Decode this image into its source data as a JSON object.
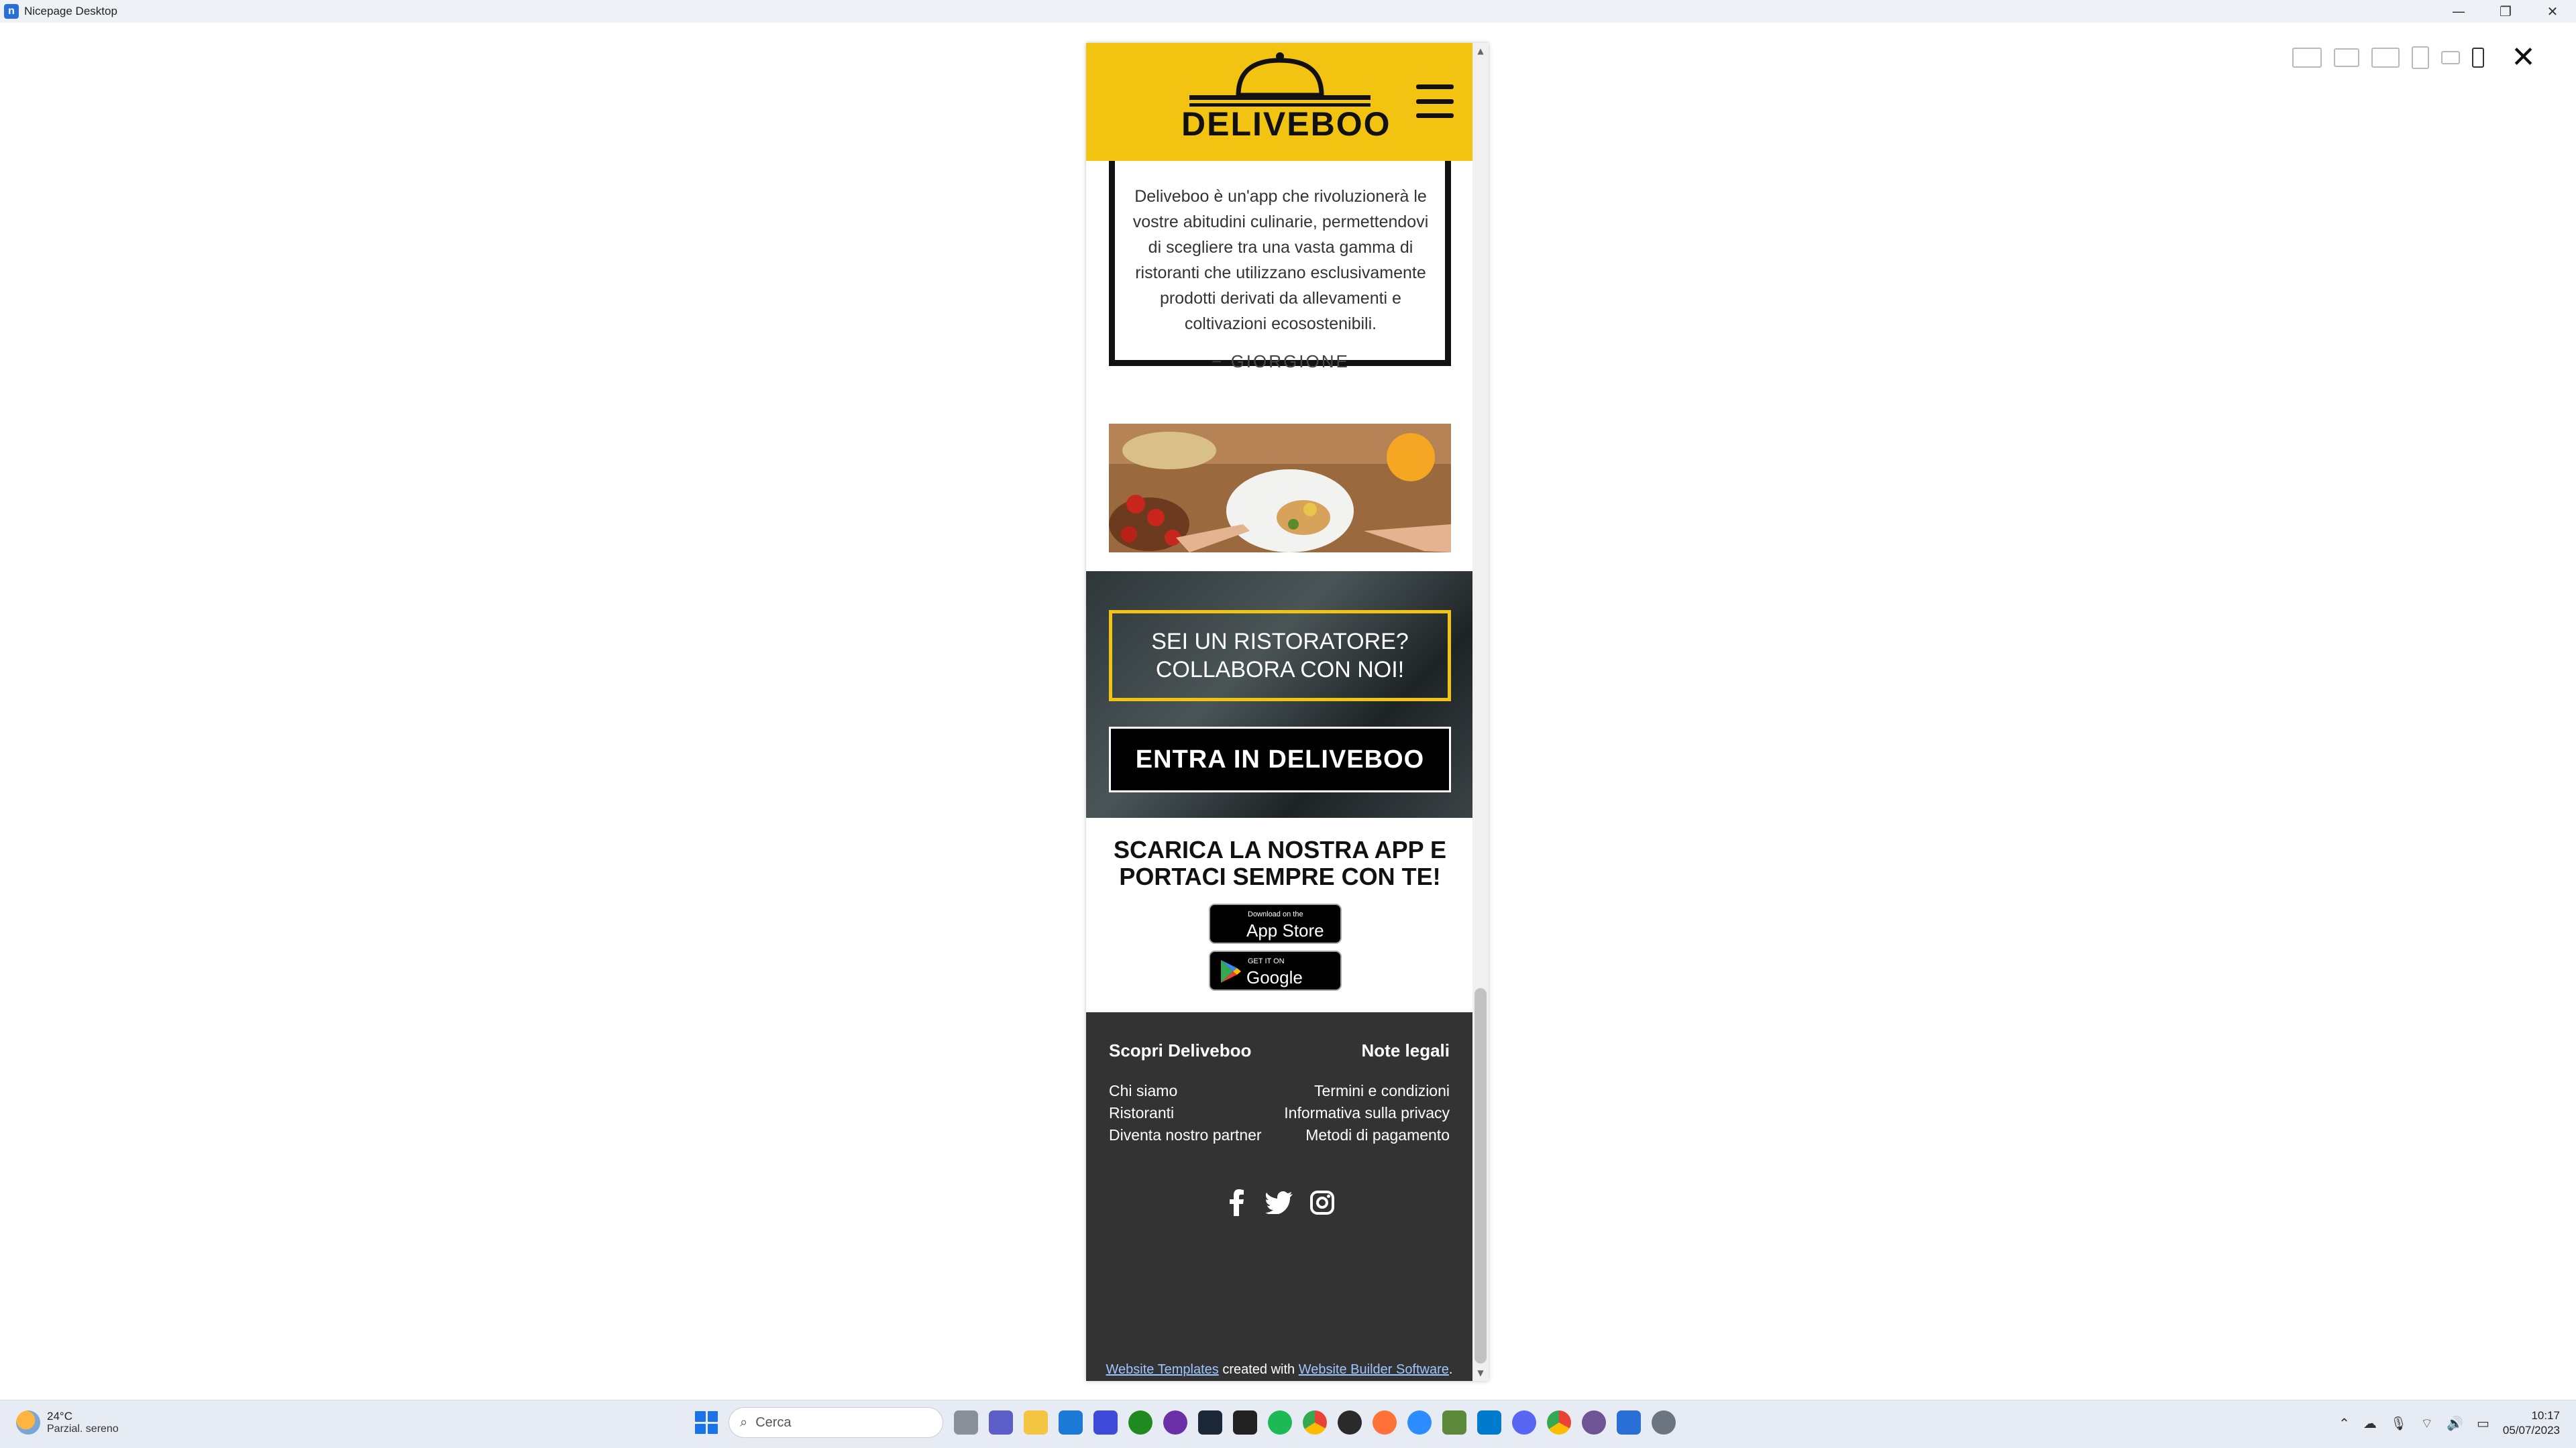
{
  "window": {
    "title": "Nicepage Desktop",
    "app_icon": "n"
  },
  "header": {
    "logo_text": "DELIVEBOO"
  },
  "testimonial": {
    "text": "Deliveboo è un'app che rivoluzionerà le vostre abitudini culinarie, permettendovi di scegliere tra una vasta gamma di ristoranti che utilizzano esclusivamente prodotti derivati da allevamenti e coltivazioni ecosostenibili.",
    "author": "− GIORGIONE"
  },
  "cta": {
    "title": "SEI UN RISTORATORE? COLLABORA CON NOI!",
    "button": "ENTRA IN DELIVEBOO"
  },
  "app_download": {
    "title": "SCARICA LA NOSTRA APP E PORTACI SEMPRE CON TE!",
    "appstore_small": "Download on the",
    "appstore_big": "App Store",
    "play_small": "GET IT ON",
    "play_big": "Google Play"
  },
  "footer": {
    "col1_title": "Scopri Deliveboo",
    "col1_links": [
      "Chi siamo",
      "Ristoranti",
      "Diventa nostro partner"
    ],
    "col2_title": "Note legali",
    "col2_links": [
      "Termini e condizioni",
      "Informativa sulla privacy",
      "Metodi di pagamento"
    ],
    "credit_link1": "Website Templates",
    "credit_mid": " created with ",
    "credit_link2": "Website Builder Software",
    "credit_end": "."
  },
  "taskbar": {
    "weather_temp": "24°C",
    "weather_desc": "Parzial. sereno",
    "search_placeholder": "Cerca",
    "time": "10:17",
    "date": "05/07/2023"
  },
  "colors": {
    "brand_yellow": "#f2c411",
    "footer_bg": "#333333"
  }
}
